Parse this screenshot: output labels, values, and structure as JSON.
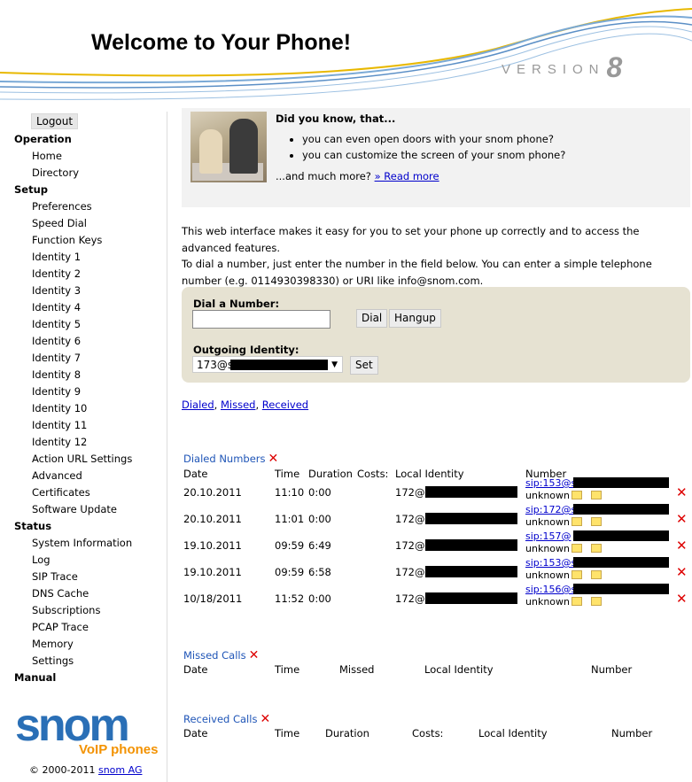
{
  "header": {
    "title": "Welcome to Your Phone!",
    "version_text": "VERSION",
    "version_number": "8"
  },
  "sidebar": {
    "logout": "Logout",
    "sections": [
      {
        "title": "Operation",
        "items": [
          "Home",
          "Directory"
        ]
      },
      {
        "title": "Setup",
        "items": [
          "Preferences",
          "Speed Dial",
          "Function Keys",
          "Identity 1",
          "Identity 2",
          "Identity 3",
          "Identity 4",
          "Identity 5",
          "Identity 6",
          "Identity 7",
          "Identity 8",
          "Identity 9",
          "Identity 10",
          "Identity 11",
          "Identity 12",
          "Action URL Settings",
          "Advanced",
          "Certificates",
          "Software Update"
        ]
      },
      {
        "title": "Status",
        "items": [
          "System Information",
          "Log",
          "SIP Trace",
          "DNS Cache",
          "Subscriptions",
          "PCAP Trace",
          "Memory",
          "Settings"
        ]
      },
      {
        "title": "Manual",
        "items": []
      }
    ],
    "logo_text": "snom",
    "logo_subtext": "VoIP phones",
    "copyright_prefix": "© 2000-2011",
    "copyright_link": "snom AG"
  },
  "did_you_know": {
    "title": "Did you know, that...",
    "bullets": [
      "you can even open doors with your snom phone?",
      "you can customize the screen of your snom phone?"
    ],
    "more_prefix": "...and much more?",
    "more_link": "» Read more"
  },
  "intro": {
    "line1": "This web interface makes it easy for you to set your phone up correctly and to access the advanced features.",
    "line2": "To dial a number, just enter the number in the field below. You can enter a simple telephone number (e.g. 0114930398330) or URI like info@snom.com."
  },
  "dial": {
    "label": "Dial a Number:",
    "input_value": "",
    "dial_button": "Dial",
    "hangup_button": "Hangup",
    "identity_label": "Outgoing Identity:",
    "identity_value": "173@s",
    "set_button": "Set"
  },
  "call_links": {
    "dialed": "Dialed",
    "missed": "Missed",
    "received": "Received"
  },
  "dialed_numbers": {
    "title": "Dialed Numbers",
    "headers": [
      "Date",
      "Time",
      "Duration",
      "Costs:",
      "Local Identity",
      "Number"
    ],
    "rows": [
      {
        "date": "20.10.2011",
        "time": "11:10",
        "duration": "0:00",
        "local": "172@s",
        "number": "sip:153@s",
        "name": "unknown"
      },
      {
        "date": "20.10.2011",
        "time": "11:01",
        "duration": "0:00",
        "local": "172@s",
        "number": "sip:172@s",
        "name": "unknown"
      },
      {
        "date": "19.10.2011",
        "time": "09:59",
        "duration": "6:49",
        "local": "172@s",
        "number": "sip:157@",
        "name": "unknown"
      },
      {
        "date": "19.10.2011",
        "time": "09:59",
        "duration": "6:58",
        "local": "172@s",
        "number": "sip:153@s",
        "name": "unknown"
      },
      {
        "date": "10/18/2011",
        "time": "11:52",
        "duration": "0:00",
        "local": "172@s",
        "number": "sip:156@s",
        "name": "unknown"
      }
    ]
  },
  "missed_calls": {
    "title": "Missed Calls",
    "headers": [
      "Date",
      "Time",
      "Missed",
      "Local Identity",
      "Number"
    ]
  },
  "received_calls": {
    "title": "Received Calls",
    "headers": [
      "Date",
      "Time",
      "Duration",
      "Costs:",
      "Local Identity",
      "Number"
    ]
  },
  "colors": {
    "link": "#0000cc",
    "delete": "#dd0000",
    "logo_blue": "#2a6fb6",
    "logo_orange": "#f39200",
    "dial_box": "#e6e2d2"
  }
}
